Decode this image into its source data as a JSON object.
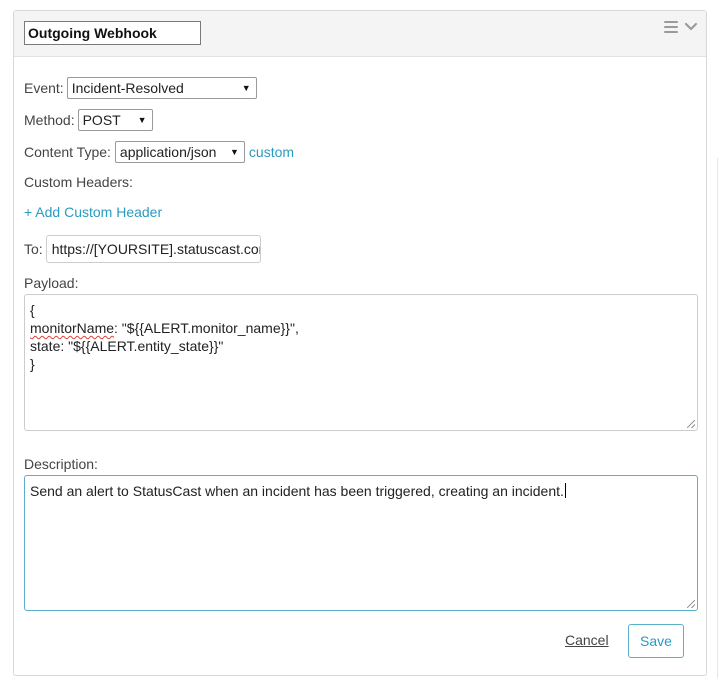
{
  "header": {
    "title": "Outgoing Webhook"
  },
  "form": {
    "event": {
      "label": "Event:",
      "selected": "Incident-Resolved"
    },
    "method": {
      "label": "Method:",
      "selected": "POST"
    },
    "content_type": {
      "label": "Content Type:",
      "selected": "application/json",
      "custom_link": "custom"
    },
    "custom_headers": {
      "label": "Custom Headers:",
      "add_link": "+ Add Custom Header"
    },
    "to": {
      "label": "To:",
      "value": "https://[YOURSITE].statuscast.com"
    },
    "payload": {
      "label": "Payload:",
      "line1": "{",
      "line2_key": "monitorName",
      "line2_rest": ": \"${{ALERT.monitor_name}}\",",
      "line3": "state: \"${{ALERT.entity_state}}\"",
      "line4": "}"
    },
    "description": {
      "label": "Description:",
      "value": "Send an alert to StatusCast when an incident has been triggered, creating an incident."
    }
  },
  "actions": {
    "cancel_label": "Cancel",
    "save_label": "Save"
  },
  "icons": {
    "menu": "hamburger-icon",
    "collapse": "chevron-down-icon",
    "dropdown": "caret-down-icon"
  },
  "colors": {
    "accent": "#2a9bc1",
    "focus_border": "#5ab0cc",
    "header_bg": "#f4f4f4"
  }
}
